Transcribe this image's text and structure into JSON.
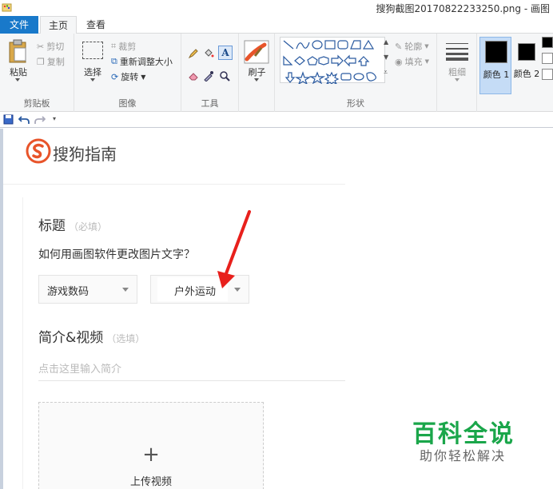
{
  "window": {
    "title": "搜狗截图20170822233250.png - 画图"
  },
  "ribbon_tabs": {
    "file": "文件",
    "home": "主页",
    "view": "查看"
  },
  "clipboard": {
    "paste": "粘贴",
    "cut": "剪切",
    "copy": "复制",
    "label": "剪贴板"
  },
  "image": {
    "select": "选择",
    "crop": "裁剪",
    "resize": "重新调整大小",
    "rotate": "旋转",
    "label": "图像"
  },
  "tools": {
    "label": "工具"
  },
  "brushes": {
    "label": "刷子"
  },
  "shapes": {
    "outline": "轮廓",
    "fill": "填充",
    "label": "形状"
  },
  "size": {
    "label": "粗细"
  },
  "colors": {
    "color1": "颜色 1",
    "color2": "颜色 2",
    "color1_hex": "#000000",
    "color2_hex": "#000000"
  },
  "canvas": {
    "logo_text": "搜狗指南",
    "title_field": {
      "label": "标题",
      "hint": "（必填）"
    },
    "question": "如何用画图软件更改图片文字？",
    "category_dropdown": "游戏数码",
    "subcategory_dropdown": "户外运动",
    "intro_field": {
      "label": "简介&视频",
      "hint": "（选填）",
      "placeholder": "点击这里输入简介"
    },
    "upload_plus": "+",
    "upload_label": "上传视频",
    "watermark_main": "百科全说",
    "watermark_sub": "助你轻松解决"
  },
  "accent_colors": {
    "file_tab": "#1979ca",
    "sogou_orange": "#e8542a",
    "arrow_red": "#e8201c",
    "watermark_green": "#1aa64a"
  }
}
